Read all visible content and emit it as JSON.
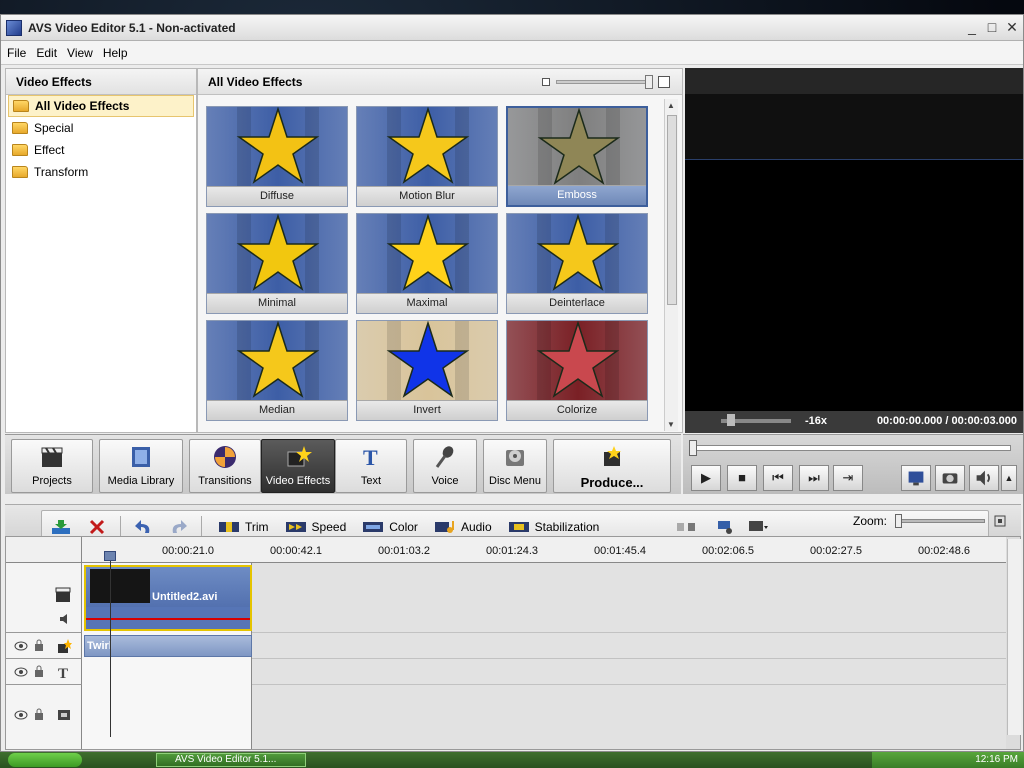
{
  "window": {
    "title": "AVS Video Editor 5.1 - Non-activated",
    "controls": [
      "_",
      "□",
      "✕"
    ]
  },
  "menu": [
    "File",
    "Edit",
    "View",
    "Help"
  ],
  "left_panel": {
    "header": "Video Effects",
    "items": [
      {
        "label": "All Video Effects",
        "selected": true
      },
      {
        "label": "Special",
        "selected": false
      },
      {
        "label": "Effect",
        "selected": false
      },
      {
        "label": "Transform",
        "selected": false
      }
    ]
  },
  "gallery": {
    "header": "All Video Effects",
    "tiles": [
      {
        "label": "Diffuse",
        "star": "#f3c214",
        "bg": "#3d5ea6"
      },
      {
        "label": "Motion Blur",
        "star": "#f5c81b",
        "bg": "#3d5ea6"
      },
      {
        "label": "Emboss",
        "star": "#8f8656",
        "bg": "#7f7f7f"
      },
      {
        "label": "Minimal",
        "star": "#f2c70f",
        "bg": "#3d5ea6"
      },
      {
        "label": "Maximal",
        "star": "#ffd21a",
        "bg": "#3d5ea6"
      },
      {
        "label": "Deinterlace",
        "star": "#f5c81b",
        "bg": "#3d5ea6"
      },
      {
        "label": "Median",
        "star": "#f5c81b",
        "bg": "#3d5ea6"
      },
      {
        "label": "Invert",
        "star": "#1034e8",
        "bg": "#d9c49a"
      },
      {
        "label": "Colorize",
        "star": "#c9484e",
        "bg": "#7a2025"
      }
    ]
  },
  "preview": {
    "speed": "-16x",
    "time": "00:00:00.000 / 00:00:03.000"
  },
  "main_toolbar": {
    "buttons": [
      {
        "label": "Projects",
        "icon": "clapper-icon"
      },
      {
        "label": "Media Library",
        "icon": "film-library-icon"
      },
      {
        "label": "Transitions",
        "icon": "transitions-icon"
      },
      {
        "label": "Video Effects",
        "icon": "video-effects-icon",
        "active": true
      },
      {
        "label": "Text",
        "icon": "text-icon"
      },
      {
        "label": "Voice",
        "icon": "microphone-icon"
      },
      {
        "label": "Disc Menu",
        "icon": "disc-menu-icon"
      },
      {
        "label": "Produce...",
        "icon": "produce-icon"
      }
    ]
  },
  "transport": {
    "buttons": [
      "▶",
      "■",
      "⏮",
      "⏭",
      "⇥"
    ]
  },
  "timeline_toolbar": {
    "tools": [
      "Trim",
      "Speed",
      "Color",
      "Audio",
      "Stabilization"
    ],
    "zoom_label": "Zoom:"
  },
  "timeline": {
    "ticks": [
      "00:00:21.0",
      "00:00:42.1",
      "00:01:03.2",
      "00:01:24.3",
      "00:01:45.4",
      "00:02:06.5",
      "00:02:27.5",
      "00:02:48.6"
    ],
    "clip_name": "Untitled2.avi",
    "effect_clip": "Twirl"
  },
  "taskbar": {
    "item": "AVS Video Editor 5.1...",
    "clock": "12:16 PM"
  },
  "colors": {
    "accent": "#3d5f9c",
    "clip": "#4462a4",
    "highlight": "#e5c400"
  }
}
